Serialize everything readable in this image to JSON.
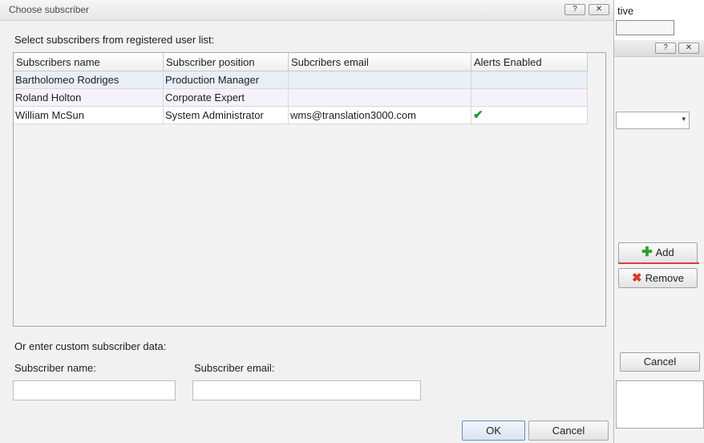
{
  "background": {
    "cell_text": "tive",
    "add_label": "Add",
    "remove_label": "Remove",
    "cancel_label": "Cancel",
    "help_glyph": "?",
    "close_glyph": "✕",
    "select_arrow": "▾"
  },
  "dialog": {
    "title": "Choose subscriber",
    "help_glyph": "?",
    "close_glyph": "✕",
    "instruction": "Select subscribers from registered user list:",
    "grid": {
      "columns": [
        "Subscribers name",
        "Subscriber position",
        "Subcribers email",
        "Alerts Enabled"
      ],
      "rows": [
        {
          "name": "Bartholomeo Rodriges",
          "position": "Production Manager",
          "email": "",
          "alerts": ""
        },
        {
          "name": "Roland Holton",
          "position": "Corporate Expert",
          "email": "",
          "alerts": ""
        },
        {
          "name": "William McSun",
          "position": "System Administrator",
          "email": "wms@translation3000.com",
          "alerts": "✔"
        }
      ]
    },
    "custom_label": "Or enter custom subscriber data:",
    "name_label": "Subscriber name:",
    "email_label": "Subscriber email:",
    "name_value": "",
    "email_value": "",
    "ok_label": "OK",
    "cancel_label": "Cancel"
  },
  "colors": {
    "selected_row": "#e9eef7",
    "check": "#1f9a2a",
    "add_icon": "#2e9d2e",
    "remove_icon": "#d33a2c",
    "add_underline": "#d94040"
  },
  "icons": {
    "add": "plus-icon",
    "remove": "x-icon",
    "alerts": "check-icon",
    "help": "help-icon",
    "close": "close-icon"
  }
}
